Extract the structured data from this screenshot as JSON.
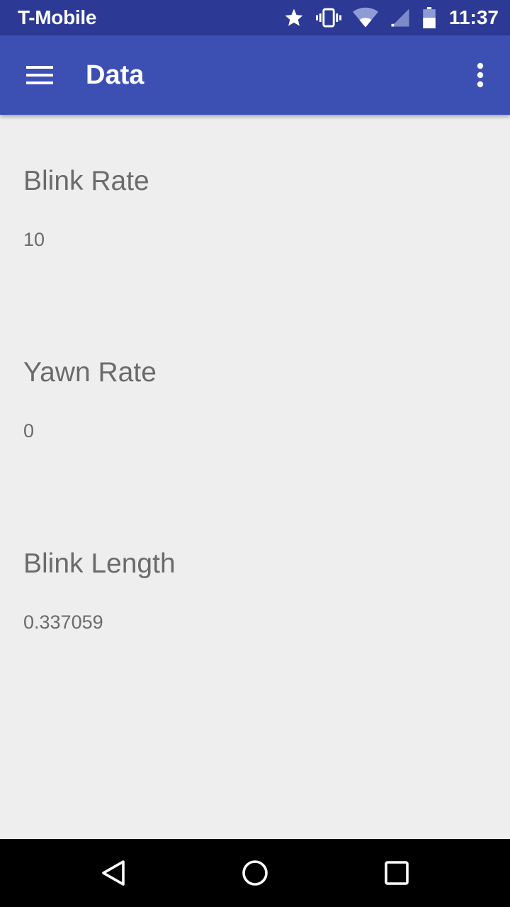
{
  "status_bar": {
    "carrier": "T-Mobile",
    "time": "11:37",
    "icons": [
      "star-icon",
      "vibrate-icon",
      "wifi-icon",
      "cell-signal-icon",
      "battery-icon"
    ]
  },
  "app_bar": {
    "title": "Data",
    "menu_icon": "hamburger-menu-icon",
    "overflow_icon": "more-vert-icon",
    "color": "#3c50b4"
  },
  "metrics": [
    {
      "label": "Blink Rate",
      "value": "10"
    },
    {
      "label": "Yawn Rate",
      "value": "0"
    },
    {
      "label": "Blink Length",
      "value": "0.337059"
    }
  ],
  "nav_bar": {
    "icons": [
      "back-icon",
      "home-icon",
      "recents-icon"
    ]
  }
}
